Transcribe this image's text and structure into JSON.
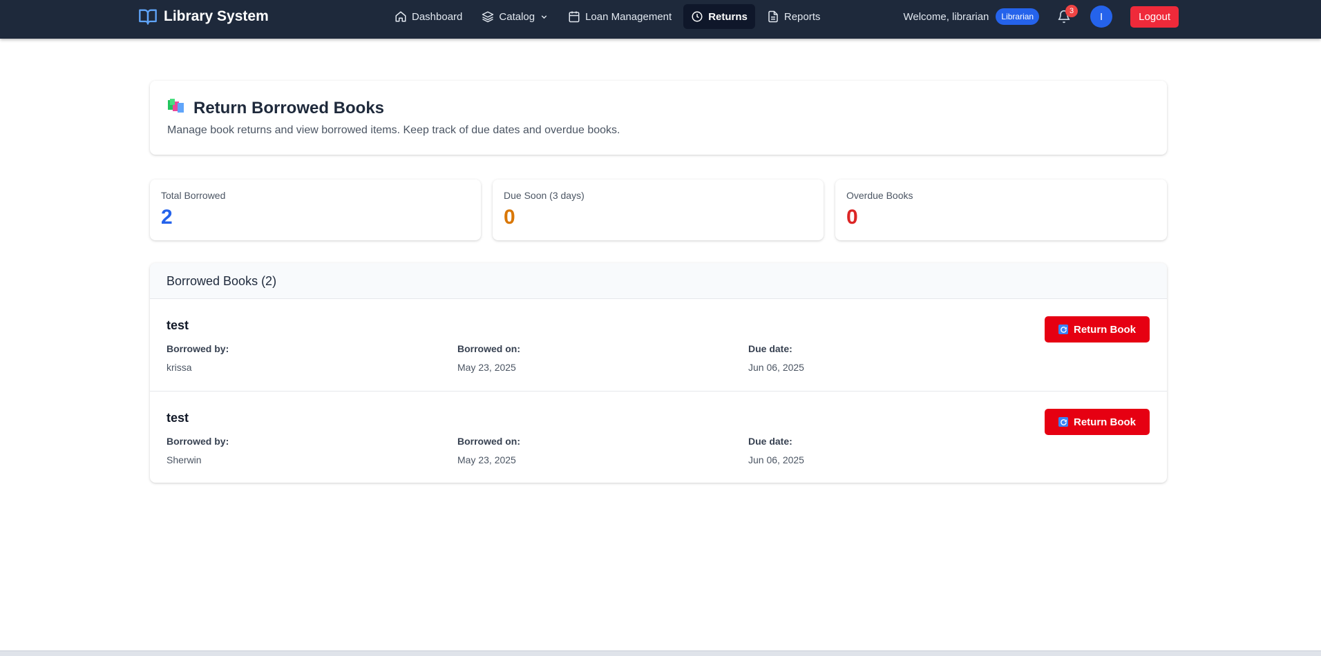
{
  "brand": {
    "name": "Library System",
    "icon": "open-book-icon"
  },
  "nav": {
    "items": [
      {
        "label": "Dashboard",
        "icon": "home-icon"
      },
      {
        "label": "Catalog",
        "icon": "layers-icon",
        "has_dropdown": true
      },
      {
        "label": "Loan Management",
        "icon": "calendar-icon"
      },
      {
        "label": "Returns",
        "icon": "clock-icon",
        "active": true
      },
      {
        "label": "Reports",
        "icon": "document-icon"
      }
    ]
  },
  "user": {
    "welcome": "Welcome, librarian",
    "role": "Librarian",
    "notifications_count": "3",
    "avatar_initial": "I",
    "logout_label": "Logout"
  },
  "page": {
    "title": "Return Borrowed Books",
    "description": "Manage book returns and view borrowed items. Keep track of due dates and overdue books."
  },
  "stats": [
    {
      "label": "Total Borrowed",
      "value": "2",
      "color": "#2563eb"
    },
    {
      "label": "Due Soon (3 days)",
      "value": "0",
      "color": "#d97706"
    },
    {
      "label": "Overdue Books",
      "value": "0",
      "color": "#dc2626"
    }
  ],
  "borrowed": {
    "header": "Borrowed Books (2)",
    "labels": {
      "borrowed_by": "Borrowed by:",
      "borrowed_on": "Borrowed on:",
      "due_date": "Due date:"
    },
    "return_label": "Return Book",
    "items": [
      {
        "title": "test",
        "borrowed_by": "krissa",
        "borrowed_on": "May 23, 2025",
        "due_date": "Jun 06, 2025"
      },
      {
        "title": "test",
        "borrowed_by": "Sherwin",
        "borrowed_on": "May 23, 2025",
        "due_date": "Jun 06, 2025"
      }
    ]
  },
  "colors": {
    "navbar": "#1e293b",
    "accent": "#2563eb",
    "danger": "#e60012"
  }
}
